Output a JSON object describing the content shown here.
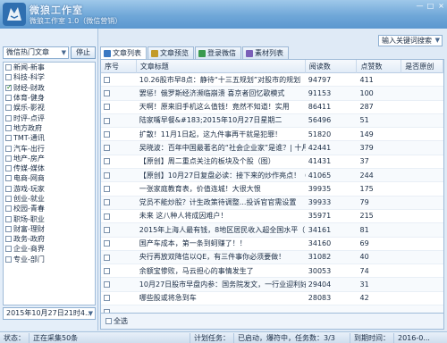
{
  "app": {
    "title": "微狼工作室",
    "version": "微狼工作室 1.0（微信营销）"
  },
  "window_controls": [
    "—",
    "□",
    "×"
  ],
  "left": {
    "category_select": "微信热门文章",
    "stop_label": "停止",
    "categories": [
      {
        "label": "新闻-新事",
        "checked": false
      },
      {
        "label": "科技-科学",
        "checked": false
      },
      {
        "label": "财经-财政",
        "checked": true
      },
      {
        "label": "体育-健身",
        "checked": false
      },
      {
        "label": "娱乐-影视",
        "checked": false
      },
      {
        "label": "时评-点评",
        "checked": false
      },
      {
        "label": "地方政府",
        "checked": false
      },
      {
        "label": "TMT-通讯",
        "checked": false
      },
      {
        "label": "汽车-出行",
        "checked": false
      },
      {
        "label": "地产-房产",
        "checked": false
      },
      {
        "label": "传媒-媒体",
        "checked": false
      },
      {
        "label": "电商-网商",
        "checked": false
      },
      {
        "label": "游戏-玩家",
        "checked": false
      },
      {
        "label": "创业-就业",
        "checked": false
      },
      {
        "label": "校园-青春",
        "checked": false
      },
      {
        "label": "职场-职业",
        "checked": false
      },
      {
        "label": "财富-理财",
        "checked": false
      },
      {
        "label": "政务-政府",
        "checked": false
      },
      {
        "label": "企业-商界",
        "checked": false
      },
      {
        "label": "专业-部门",
        "checked": false
      }
    ],
    "date_select": "2015年10月27日21时4..."
  },
  "right": {
    "search_select": "输入关键词搜索",
    "tabs": [
      {
        "label": "文章列表",
        "active": true,
        "icon": "document-icon"
      },
      {
        "label": "文章预览",
        "active": false,
        "icon": "preview-icon"
      },
      {
        "label": "登录微信",
        "active": false,
        "icon": "login-icon"
      },
      {
        "label": "素材列表",
        "active": false,
        "icon": "material-icon"
      }
    ],
    "columns": [
      "序号",
      "文章标题",
      "阅读数",
      "点赞数",
      "是否原创"
    ],
    "rows": [
      {
        "title": "10.26股市早8点：静待“十三五规划”对股市的规划",
        "read": "94797",
        "like": "411",
        "orig": ""
      },
      {
        "title": "罢惩！俄罗斯经济濒临崩溃 喜京者回忆歌模式",
        "read": "91153",
        "like": "100",
        "orig": ""
      },
      {
        "title": "天啊！原来旧手机这么值钱！竟然不知道！实用",
        "read": "86411",
        "like": "287",
        "orig": ""
      },
      {
        "title": "陆家嘴早餐&#183;2015年10月27日星期二",
        "read": "56496",
        "like": "51",
        "orig": ""
      },
      {
        "title": "扩散！11月1日起，这九件事再干就是犯罪！",
        "read": "51820",
        "like": "149",
        "orig": ""
      },
      {
        "title": "吴晓波：百年中国最著名的“社会企业家”是谁？| 十月纪念",
        "read": "42441",
        "like": "379",
        "orig": ""
      },
      {
        "title": "【原创】周二重点关注的板块及个股（图）",
        "read": "41431",
        "like": "37",
        "orig": ""
      },
      {
        "title": "【原创】10月27日复盘必读：接下来的炒作亮点！（附老揭...",
        "read": "41065",
        "like": "244",
        "orig": ""
      },
      {
        "title": "一张家庭教育表，价值连城！大很大恨",
        "read": "39935",
        "like": "175",
        "orig": ""
      },
      {
        "title": "党员不能炒股？计生政策待调整...投诉官官需设置",
        "read": "39933",
        "like": "79",
        "orig": ""
      },
      {
        "title": "未来 这八种人将成因难户！",
        "read": "35971",
        "like": "215",
        "orig": ""
      },
      {
        "title": "2015年上海人最有钱，8地区居民收入超全国水平（中国人3...",
        "read": "34161",
        "like": "81",
        "orig": ""
      },
      {
        "title": "国产车成本，第一条到蚵赚了！！",
        "read": "34160",
        "like": "69",
        "orig": ""
      },
      {
        "title": "央行再放双降信以QE，有三件事你必须要做！",
        "read": "31082",
        "like": "40",
        "orig": ""
      },
      {
        "title": "余额宝惨败，马云担心的事情发生了",
        "read": "30053",
        "like": "74",
        "orig": ""
      },
      {
        "title": "10月27日股市早盘内参：国务院发文，一行业迎利好",
        "read": "29404",
        "like": "31",
        "orig": ""
      },
      {
        "title": "哪些股或将急到车",
        "read": "28083",
        "like": "42",
        "orig": ""
      },
      {
        "title": "",
        "read": "",
        "like": "",
        "orig": ""
      }
    ],
    "select_all_label": "全选"
  },
  "status": {
    "state": "状态：",
    "collecting": "正在采集50条",
    "task_status": "计划任务：",
    "progress": "已启动，爆符中，任务数：3/3",
    "expire": "到期时间：",
    "expire_date": "2016-0..."
  }
}
